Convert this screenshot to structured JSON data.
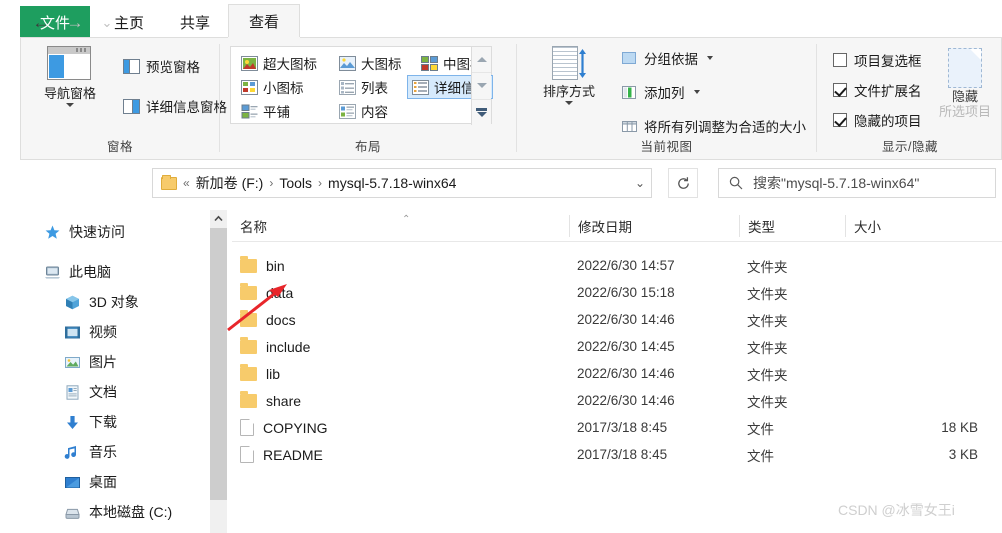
{
  "tabs": [
    {
      "label": "文件",
      "name": "tab-file"
    },
    {
      "label": "主页",
      "name": "tab-home"
    },
    {
      "label": "共享",
      "name": "tab-share"
    },
    {
      "label": "查看",
      "name": "tab-view"
    }
  ],
  "ribbon": {
    "groups": [
      {
        "label": "窗格"
      },
      {
        "label": "布局"
      },
      {
        "label": "当前视图"
      },
      {
        "label": "显示/隐藏"
      }
    ],
    "panes": {
      "nav_pane": "导航窗格",
      "preview_pane": "预览窗格",
      "details_pane": "详细信息窗格"
    },
    "layout": {
      "items": [
        {
          "label": "超大图标",
          "selected": false
        },
        {
          "label": "大图标",
          "selected": false
        },
        {
          "label": "中图标",
          "selected": false
        },
        {
          "label": "小图标",
          "selected": false
        },
        {
          "label": "列表",
          "selected": false
        },
        {
          "label": "详细信息",
          "selected": true
        },
        {
          "label": "平铺",
          "selected": false
        },
        {
          "label": "内容",
          "selected": false
        }
      ]
    },
    "current_view": {
      "sort_by": "排序方式",
      "group_by": "分组依据",
      "add_columns": "添加列",
      "size_all_columns": "将所有列调整为合适的大小"
    },
    "show_hide": {
      "item_checkboxes": {
        "label": "项目复选框",
        "checked": false
      },
      "file_extensions": {
        "label": "文件扩展名",
        "checked": true
      },
      "hidden_items": {
        "label": "隐藏的项目",
        "checked": true
      },
      "hide_selected": {
        "line1": "隐藏",
        "line2": "所选项目"
      }
    }
  },
  "address": {
    "back_icon": "arrow-left-icon",
    "forward_icon": "arrow-right-icon",
    "recent_icon": "chevron-down-icon",
    "up_icon": "arrow-up-icon",
    "folder_icon": "folder-icon",
    "overflow": "«",
    "crumbs": [
      "新加卷 (F:)",
      "Tools",
      "mysql-5.7.18-winx64"
    ],
    "separator": "›",
    "dropdown": "⌄",
    "refresh_icon": "refresh-icon"
  },
  "search": {
    "icon": "search-icon",
    "placeholder": "搜索\"mysql-5.7.18-winx64\""
  },
  "sidebar": {
    "items": [
      {
        "label": "快速访问",
        "icon": "star-icon",
        "indent": 0
      },
      {
        "label": "此电脑",
        "icon": "computer-icon",
        "indent": 0
      },
      {
        "label": "3D 对象",
        "icon": "cube-icon",
        "indent": 1
      },
      {
        "label": "视频",
        "icon": "video-icon",
        "indent": 1
      },
      {
        "label": "图片",
        "icon": "picture-icon",
        "indent": 1
      },
      {
        "label": "文档",
        "icon": "document-icon",
        "indent": 1
      },
      {
        "label": "下载",
        "icon": "download-icon",
        "indent": 1
      },
      {
        "label": "音乐",
        "icon": "music-icon",
        "indent": 1
      },
      {
        "label": "桌面",
        "icon": "desktop-icon",
        "indent": 1
      },
      {
        "label": "本地磁盘 (C:)",
        "icon": "disk-icon",
        "indent": 1
      }
    ]
  },
  "filelist": {
    "columns": [
      {
        "label": "名称",
        "sorted": "asc"
      },
      {
        "label": "修改日期",
        "sorted": ""
      },
      {
        "label": "类型",
        "sorted": ""
      },
      {
        "label": "大小",
        "sorted": ""
      }
    ],
    "rows": [
      {
        "name": "bin",
        "date": "2022/6/30 14:57",
        "type": "文件夹",
        "size": "",
        "icon": "folder-icon"
      },
      {
        "name": "data",
        "date": "2022/6/30 15:18",
        "type": "文件夹",
        "size": "",
        "icon": "folder-icon"
      },
      {
        "name": "docs",
        "date": "2022/6/30 14:46",
        "type": "文件夹",
        "size": "",
        "icon": "folder-icon"
      },
      {
        "name": "include",
        "date": "2022/6/30 14:45",
        "type": "文件夹",
        "size": "",
        "icon": "folder-icon"
      },
      {
        "name": "lib",
        "date": "2022/6/30 14:46",
        "type": "文件夹",
        "size": "",
        "icon": "folder-icon"
      },
      {
        "name": "share",
        "date": "2022/6/30 14:46",
        "type": "文件夹",
        "size": "",
        "icon": "folder-icon"
      },
      {
        "name": "COPYING",
        "date": "2017/3/18 8:45",
        "type": "文件",
        "size": "18 KB",
        "icon": "file-icon"
      },
      {
        "name": "README",
        "date": "2017/3/18 8:45",
        "type": "文件",
        "size": "3 KB",
        "icon": "file-icon"
      }
    ]
  },
  "annotation": {
    "arrow_color": "#e8262b",
    "target_row": "data"
  },
  "watermark": {
    "text": "CSDN @冰雪女王i"
  },
  "colors": {
    "file_tab_green": "#1e9e5f",
    "selection_blue": "#d6eafc",
    "selection_border": "#7eb4ea",
    "folder_yellow": "#f7cb6b",
    "ribbon_bg": "#f6f6f6"
  }
}
